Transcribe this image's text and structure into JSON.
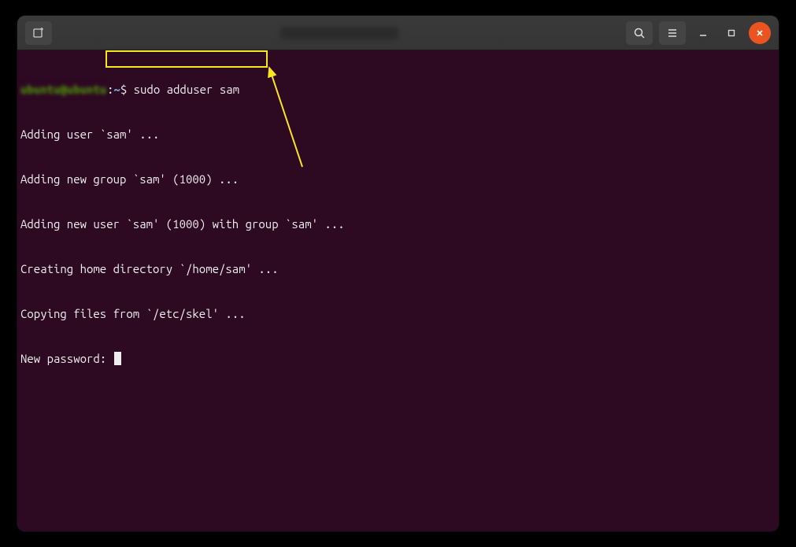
{
  "titlebar": {
    "title": "ubuntu@ubuntu: ~"
  },
  "terminal": {
    "prompt_symbol": "$",
    "prompt_path": "~",
    "prompt_separator": ":",
    "command": "sudo adduser sam",
    "output_line1": "Adding user `sam' ...",
    "output_line2": "Adding new group `sam' (1000) ...",
    "output_line3": "Adding new user `sam' (1000) with group `sam' ...",
    "output_line4": "Creating home directory `/home/sam' ...",
    "output_line5": "Copying files from `/etc/skel' ...",
    "password_prompt": "New password: "
  }
}
